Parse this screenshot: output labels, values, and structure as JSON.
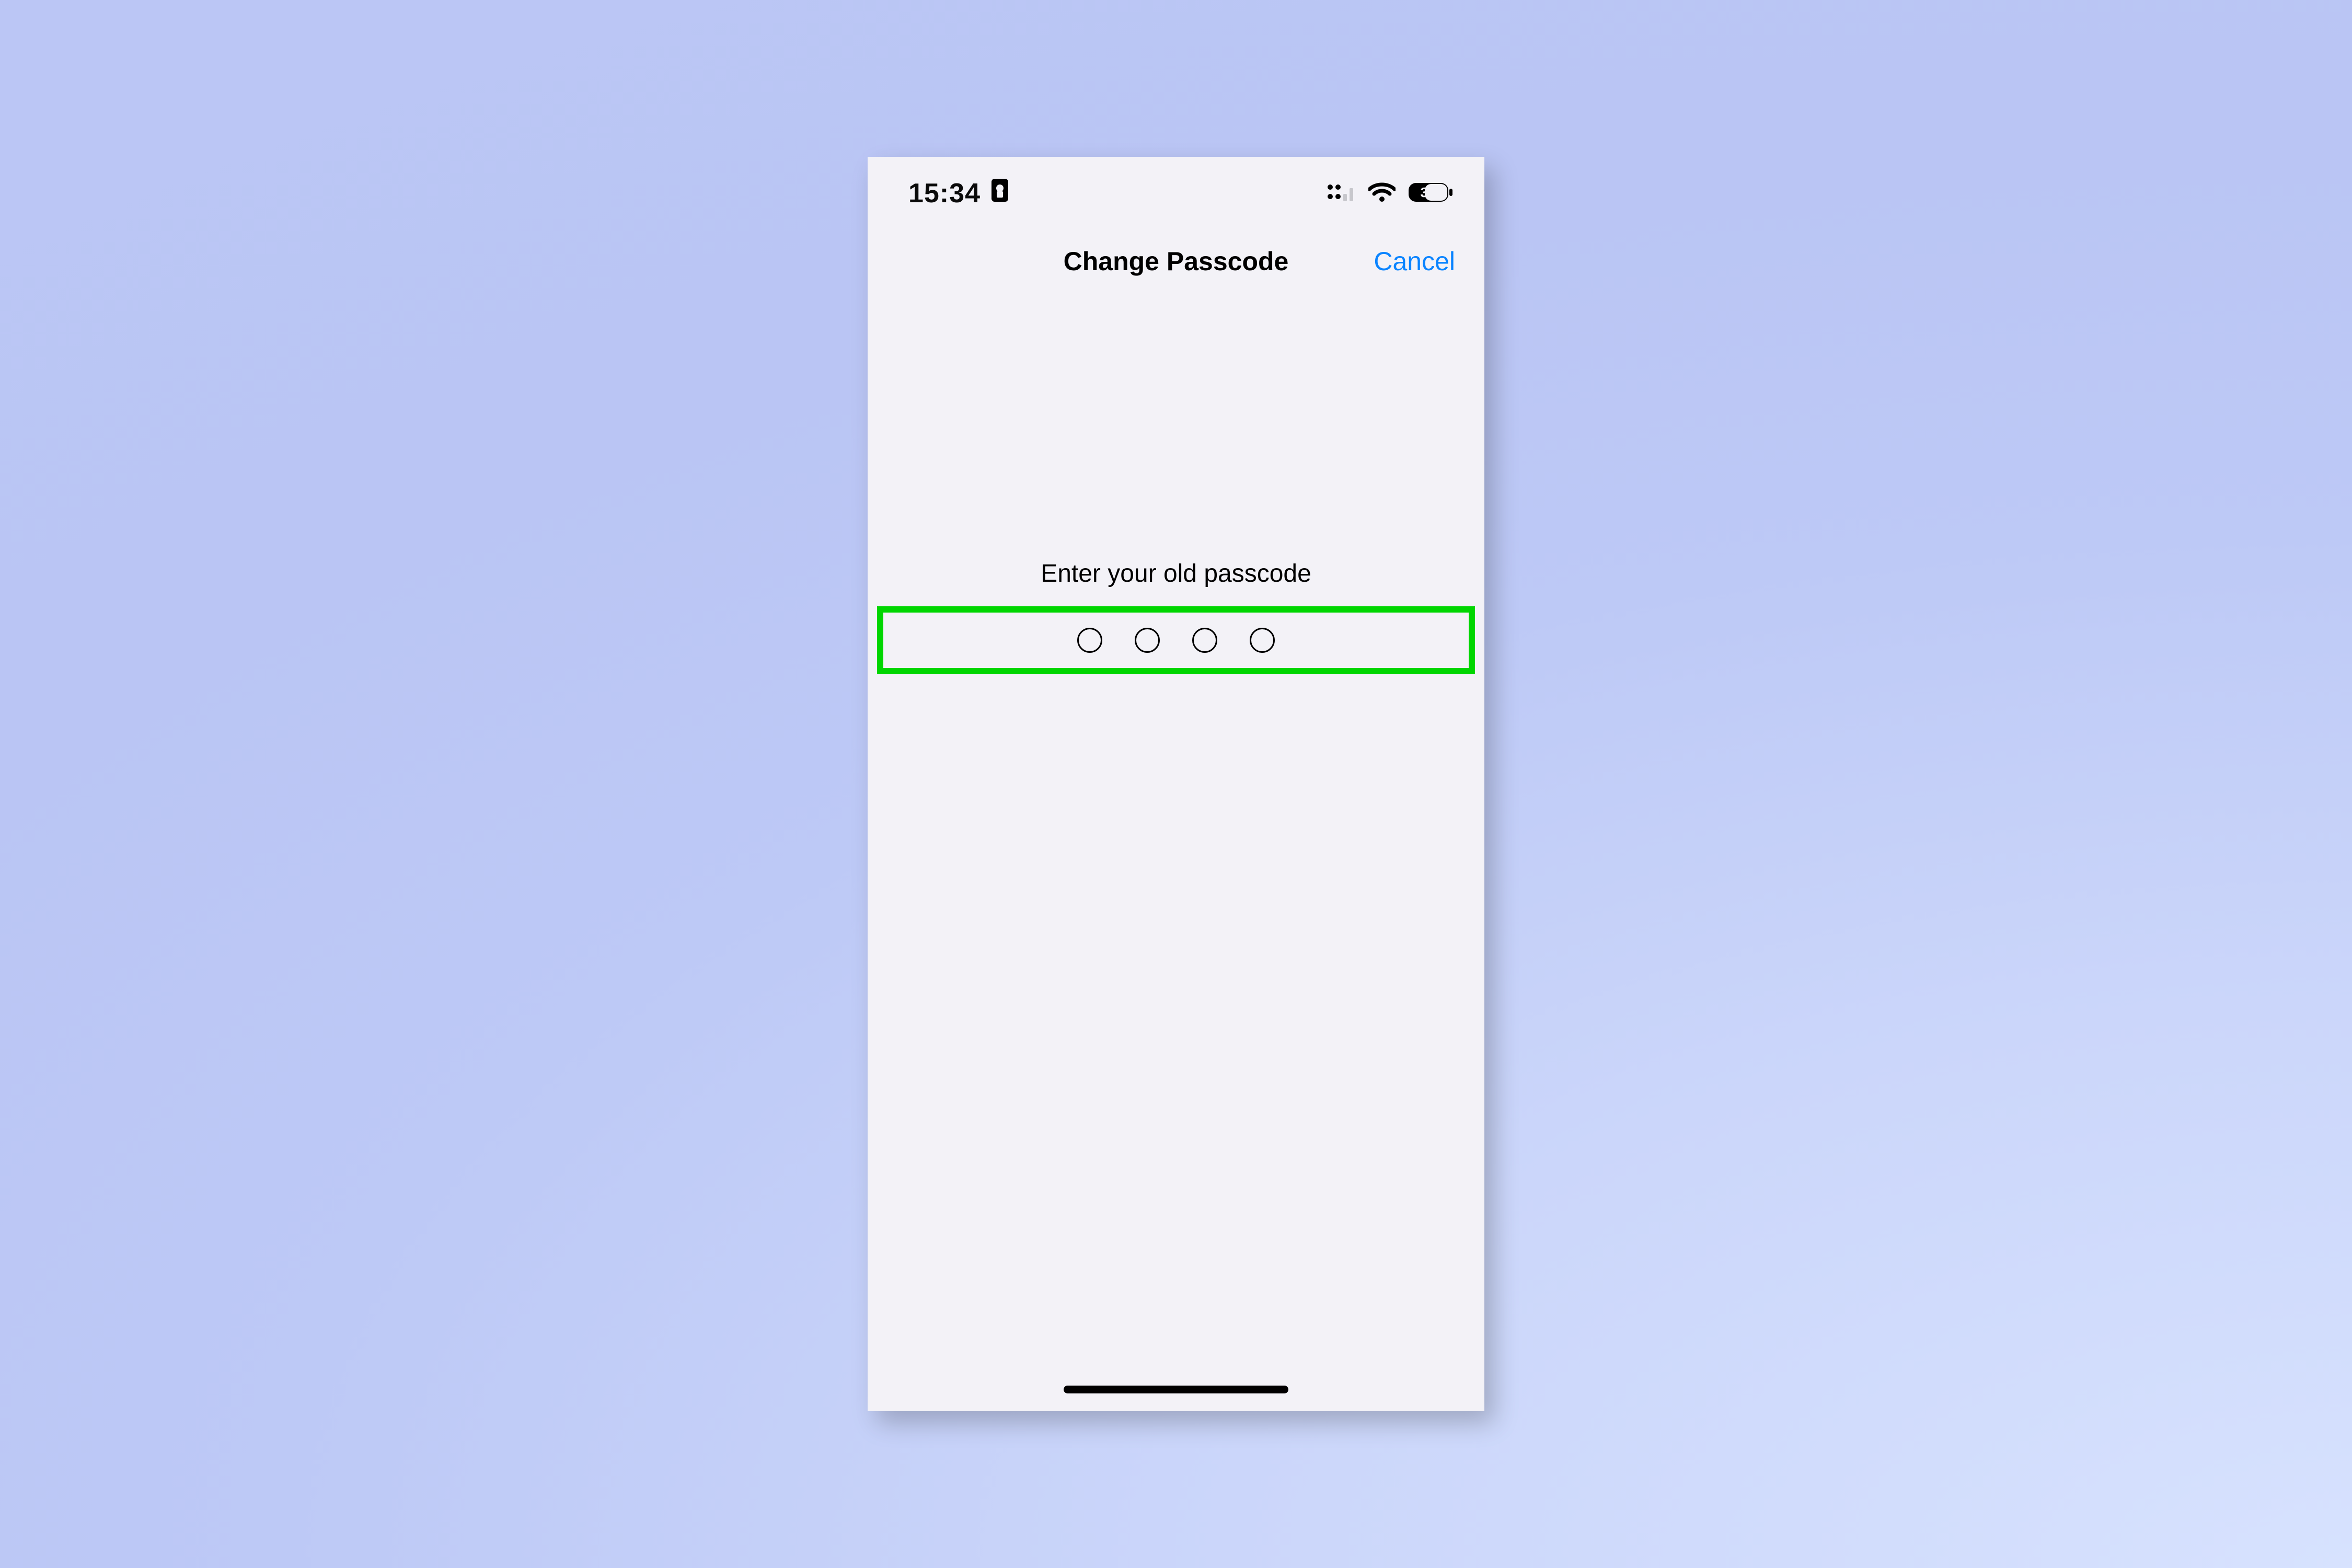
{
  "status_bar": {
    "time": "15:34",
    "portrait_lock_icon": "portrait-lock-icon",
    "cellular_icon": "cellular-icon",
    "wifi_icon": "wifi-icon",
    "battery_percent": "38"
  },
  "nav": {
    "title": "Change Passcode",
    "cancel_label": "Cancel"
  },
  "content": {
    "prompt": "Enter your old passcode",
    "passcode_length": 4,
    "entered_digits": 0
  },
  "annotation": {
    "highlight_color": "#00D600"
  },
  "colors": {
    "ios_blue": "#0A84FF",
    "screen_bg": "#F3F2F7"
  }
}
